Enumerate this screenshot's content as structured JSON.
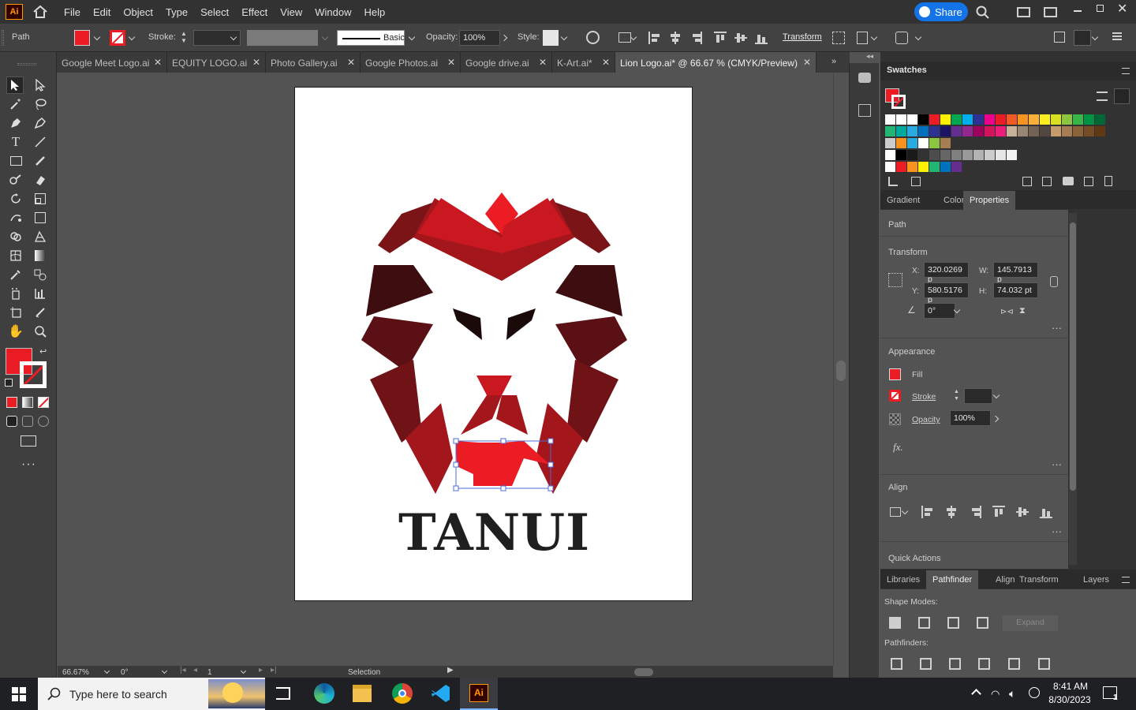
{
  "app": {
    "logo_text": "Ai"
  },
  "menu": [
    "File",
    "Edit",
    "Object",
    "Type",
    "Select",
    "Effect",
    "View",
    "Window",
    "Help"
  ],
  "share": {
    "label": "Share"
  },
  "control_bar": {
    "selection_type": "Path",
    "stroke_label": "Stroke:",
    "brush_label": "Basic",
    "opacity_label": "Opacity:",
    "opacity_value": "100%",
    "style_label": "Style:",
    "transform_label": "Transform"
  },
  "tabs": [
    {
      "label": "Google Meet Logo.ai",
      "active": false
    },
    {
      "label": "EQUITY LOGO.ai",
      "active": false
    },
    {
      "label": "Photo Gallery.ai",
      "active": false
    },
    {
      "label": "Google Photos.ai",
      "active": false
    },
    {
      "label": "Google drive.ai",
      "active": false
    },
    {
      "label": "K-Art.ai*",
      "active": false
    },
    {
      "label": "Lion Logo.ai* @ 66.67 % (CMYK/Preview)",
      "active": true
    }
  ],
  "artwork": {
    "wordmark": "TANUI"
  },
  "colors": {
    "fill": "#ec1c24",
    "dark_red": "#7a1417",
    "mid_red": "#a3161c",
    "darkest": "#3d0d10",
    "accent_blue": "#1473e6"
  },
  "swatches_panel": {
    "title": "Swatches"
  },
  "properties_tabs": [
    "Gradient",
    "Color",
    "Properties"
  ],
  "properties": {
    "object_type": "Path",
    "transform_title": "Transform",
    "x_label": "X:",
    "x_value": "320.0269 p",
    "y_label": "Y:",
    "y_value": "580.5176 p",
    "w_label": "W:",
    "w_value": "145.7913 p",
    "h_label": "H:",
    "h_value": "74.032 pt",
    "angle_value": "0°",
    "appearance_title": "Appearance",
    "fill_label": "Fill",
    "stroke_label": "Stroke",
    "opacity_label": "Opacity",
    "opacity_value": "100%",
    "fx_label": "fx.",
    "align_title": "Align",
    "quick_actions_title": "Quick Actions"
  },
  "bottom_tabs": [
    "Libraries",
    "Pathfinder",
    "Align",
    "Transform",
    "Layers"
  ],
  "pathfinder": {
    "shape_modes_label": "Shape Modes:",
    "expand_label": "Expand",
    "pathfinders_label": "Pathfinders:"
  },
  "status": {
    "zoom": "66.67%",
    "rotation": "0°",
    "artboard_number": "1",
    "tool_name": "Selection"
  },
  "taskbar": {
    "search_placeholder": "Type here to search",
    "time": "8:41 AM",
    "date": "8/30/2023",
    "notification_count": "1",
    "ai_label": "Ai"
  }
}
